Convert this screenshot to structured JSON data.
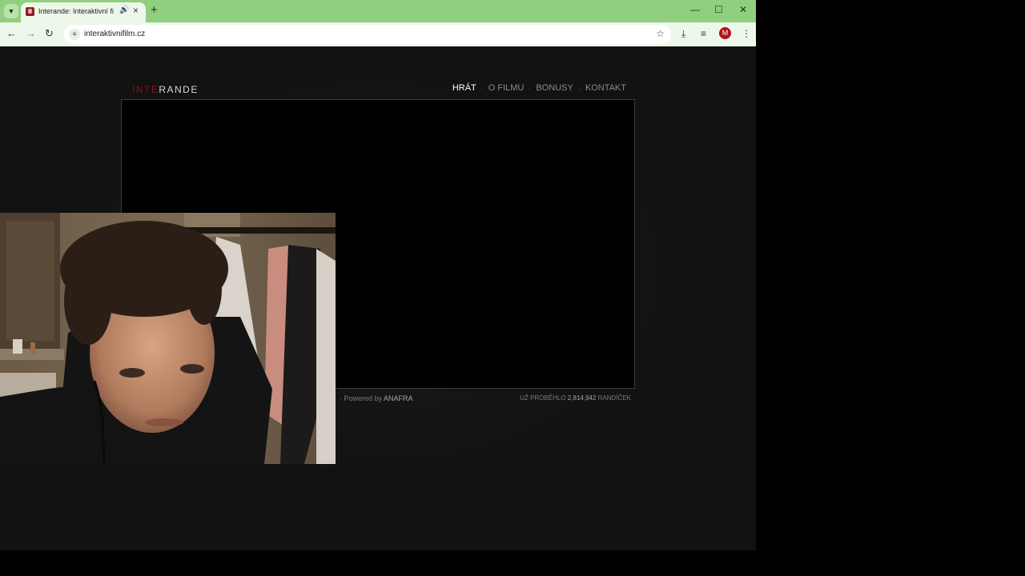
{
  "browser": {
    "tab_title": "Interande: Interaktivní film",
    "url": "interaktivnifilm.cz",
    "profile_initial": "M",
    "icons": {
      "tab_search": "chevron-down-icon",
      "audio": "speaker-icon",
      "close_tab": "close-icon",
      "new_tab": "plus-icon",
      "minimize": "minimize-icon",
      "maximize": "maximize-icon",
      "close_window": "close-icon",
      "back": "arrow-left-icon",
      "forward": "arrow-right-icon",
      "reload": "reload-icon",
      "site_info": "tune-icon",
      "bookmark": "star-icon",
      "download": "download-icon",
      "media": "media-control-icon",
      "menu": "kebab-menu-icon"
    },
    "colors": {
      "frame": "#8fcf7e",
      "toolbar": "#eef8ea",
      "profile": "#b3111b"
    }
  },
  "site": {
    "logo_accent": "INTE",
    "logo_main": "RANDE",
    "nav": [
      {
        "label": "HRÁT",
        "active": true
      },
      {
        "label": "O FILMU",
        "active": false
      },
      {
        "label": "BONUSY",
        "active": false
      },
      {
        "label": "KONTAKT",
        "active": false
      }
    ],
    "footer": {
      "powered_prefix": "· Powered by",
      "powered_brand": "ANAFRA",
      "stats_prefix": "UŽ PROBĚHLO",
      "stats_count": "2,814,942",
      "stats_suffix": "RANDÍČEK"
    },
    "colors": {
      "accent": "#8d0f15",
      "background": "#121212"
    }
  }
}
